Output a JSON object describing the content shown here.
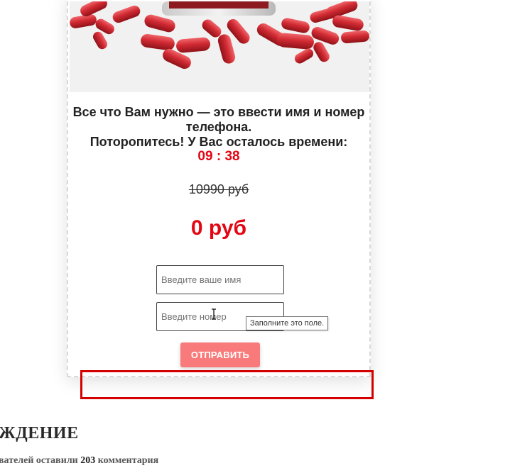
{
  "card": {
    "headline_line1": "Все что Вам нужно — это ввести имя и номер",
    "headline_line2": "телефона.",
    "headline_line3": "Поторопитесь! У Вас осталось времени:",
    "timer": "09 : 38",
    "old_price": "10990 руб",
    "new_price": "0 руб"
  },
  "form": {
    "name_placeholder": "Введите ваше имя",
    "phone_placeholder": "Введите номер",
    "validation_tooltip": "Заполните это поле.",
    "submit_label": "ОТПРАВИТЬ"
  },
  "section": {
    "title": "ЖДЕНИЕ",
    "comments_prefix": "вателей оставили",
    "comments_count": "203",
    "comments_suffix": "комментария"
  },
  "colors": {
    "accent_red": "#e30613",
    "button_pink": "#f97a7a",
    "highlight_red": "#d40000"
  },
  "icons": {
    "cursor": "text-cursor-icon"
  }
}
